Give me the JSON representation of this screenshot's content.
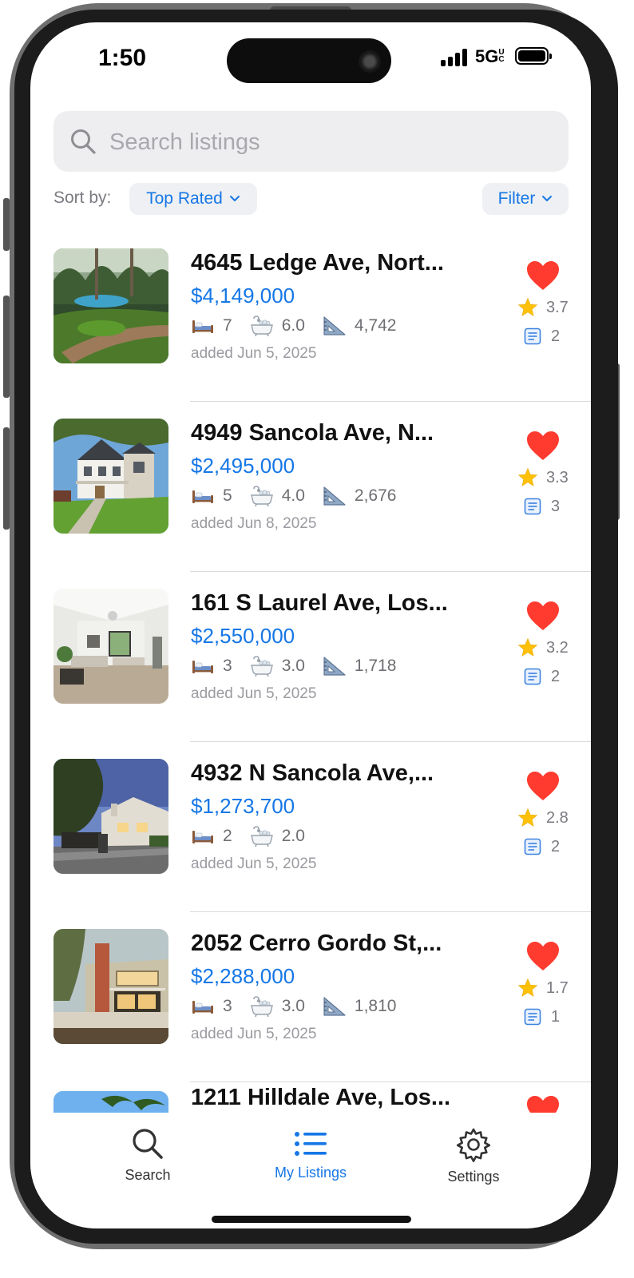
{
  "status_bar": {
    "time": "1:50",
    "network": "5G",
    "network_sub": "UC"
  },
  "search": {
    "placeholder": "Search listings",
    "value": ""
  },
  "sort": {
    "label": "Sort by:",
    "selected": "Top Rated"
  },
  "filter": {
    "label": "Filter"
  },
  "colors": {
    "accent": "#1677e6",
    "heart": "#ff3b30",
    "star": "#ffc107"
  },
  "listings": [
    {
      "address": "4645 Ledge Ave, Nort...",
      "price": "$4,149,000",
      "beds": "7",
      "baths": "6.0",
      "sqft": "4,742",
      "added": "added Jun 5, 2025",
      "rating": "3.7",
      "notes": "2",
      "favorite": true,
      "image": "backyard-pool"
    },
    {
      "address": "4949 Sancola Ave, N...",
      "price": "$2,495,000",
      "beds": "5",
      "baths": "4.0",
      "sqft": "2,676",
      "added": "added Jun 8, 2025",
      "rating": "3.3",
      "notes": "3",
      "favorite": true,
      "image": "white-farmhouse"
    },
    {
      "address": "161 S Laurel Ave, Los...",
      "price": "$2,550,000",
      "beds": "3",
      "baths": "3.0",
      "sqft": "1,718",
      "added": "added Jun 5, 2025",
      "rating": "3.2",
      "notes": "2",
      "favorite": true,
      "image": "living-room"
    },
    {
      "address": "4932 N Sancola Ave,...",
      "price": "$1,273,700",
      "beds": "2",
      "baths": "2.0",
      "sqft": "",
      "added": "added Jun 5, 2025",
      "rating": "2.8",
      "notes": "2",
      "favorite": true,
      "image": "dusk-house"
    },
    {
      "address": "2052 Cerro Gordo St,...",
      "price": "$2,288,000",
      "beds": "3",
      "baths": "3.0",
      "sqft": "1,810",
      "added": "added Jun 5, 2025",
      "rating": "1.7",
      "notes": "1",
      "favorite": true,
      "image": "brick-chimney-house"
    },
    {
      "address": "1211 Hilldale Ave, Los...",
      "price": "",
      "beds": "",
      "baths": "",
      "sqft": "",
      "added": "",
      "rating": "",
      "notes": "",
      "favorite": true,
      "image": "sky-palms"
    }
  ],
  "tabs": [
    {
      "label": "Search",
      "icon": "search-icon",
      "active": false
    },
    {
      "label": "My Listings",
      "icon": "list-icon",
      "active": true
    },
    {
      "label": "Settings",
      "icon": "gear-icon",
      "active": false
    }
  ]
}
